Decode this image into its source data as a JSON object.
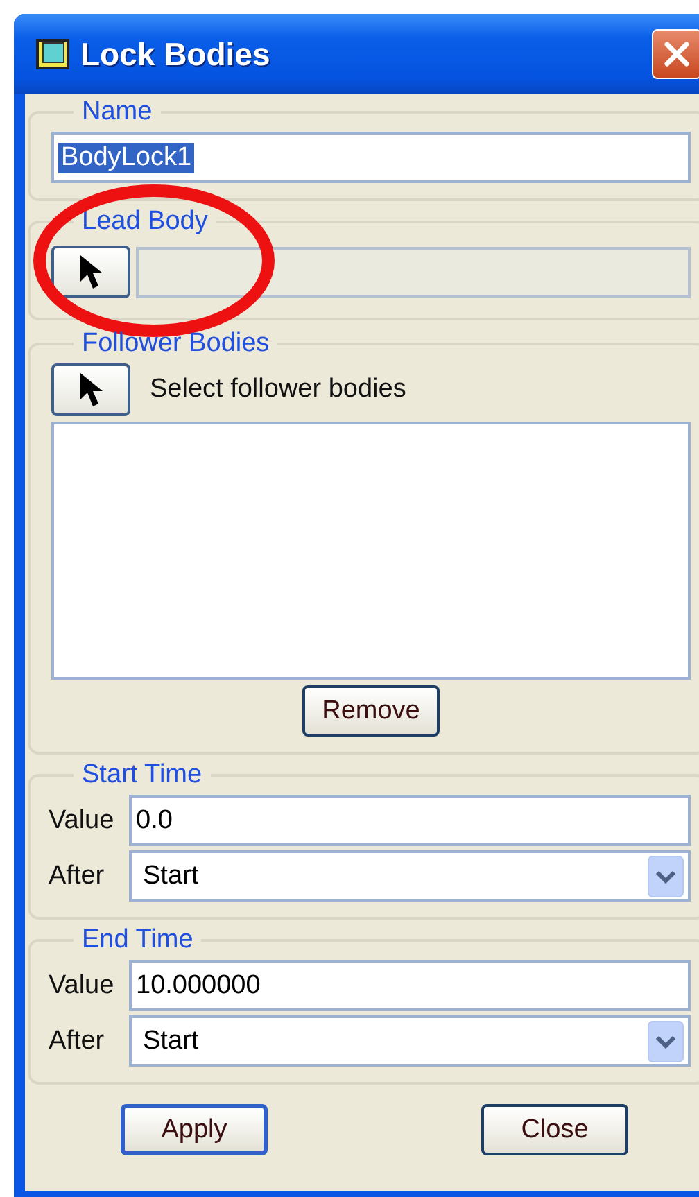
{
  "window": {
    "title": "Lock Bodies"
  },
  "name": {
    "legend": "Name",
    "value": "BodyLock1",
    "text_selected": true
  },
  "lead_body": {
    "legend": "Lead Body",
    "field_disabled": true
  },
  "follower_bodies": {
    "legend": "Follower Bodies",
    "prompt": "Select follower bodies",
    "remove_button": "Remove"
  },
  "times": [
    {
      "legend": "Start Time",
      "value_label": "Value",
      "value": "0.0",
      "after_label": "After",
      "after": "Start"
    },
    {
      "legend": "End Time",
      "value_label": "Value",
      "value": "10.000000",
      "after_label": "After",
      "after": "Start"
    }
  ],
  "buttons": [
    {
      "label": "Apply",
      "default": true
    },
    {
      "label": "Close",
      "default": false
    }
  ]
}
